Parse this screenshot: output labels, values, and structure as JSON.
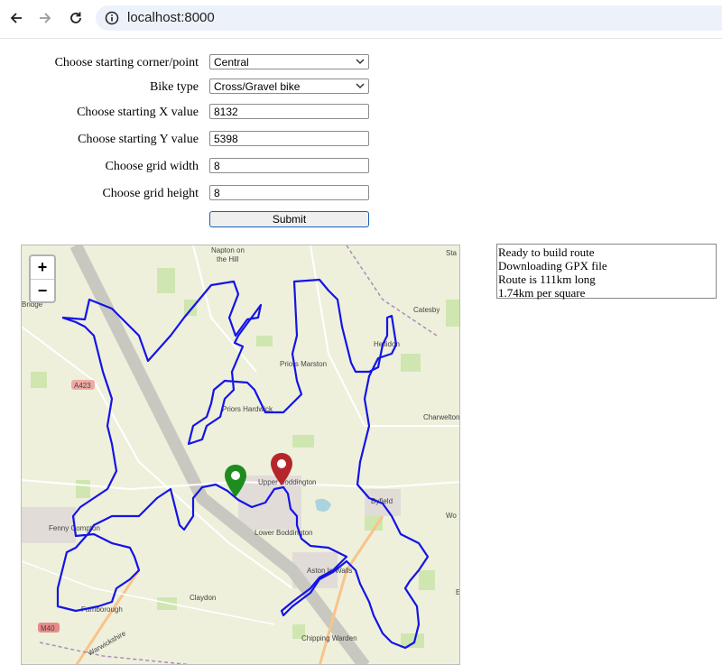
{
  "browser": {
    "url": "localhost:8000",
    "back_icon": "arrow-left-icon",
    "forward_icon": "arrow-right-icon",
    "reload_icon": "reload-icon",
    "site_info_icon": "info-icon"
  },
  "form": {
    "start_point": {
      "label": "Choose starting corner/point",
      "value": "Central"
    },
    "bike_type": {
      "label": "Bike type",
      "value": "Cross/Gravel bike"
    },
    "start_x": {
      "label": "Choose starting X value",
      "value": "8132"
    },
    "start_y": {
      "label": "Choose starting Y value",
      "value": "5398"
    },
    "grid_width": {
      "label": "Choose grid width",
      "value": "8"
    },
    "grid_height": {
      "label": "Choose grid height",
      "value": "8"
    },
    "submit_label": "Submit"
  },
  "map": {
    "zoom_in": "+",
    "zoom_out": "−",
    "route_color": "#1414e6",
    "start_marker_color": "#1e8c1e",
    "end_marker_color": "#b5262b",
    "places": {
      "napton": "Napton on",
      "napton2": "the Hill",
      "bridge": "Bridge",
      "priors_marston": "Priors Marston",
      "priors_hardwick": "Priors Hardwick",
      "catesby": "Catesby",
      "hellidon": "Hellidon",
      "charwelton": "Charwelton",
      "upper_boddington": "Upper Boddington",
      "byfield": "Byfield",
      "fenny_compton": "Fenny Compton",
      "lower_boddington": "Lower Boddington",
      "aston_walls": "Aston le Walls",
      "claydon": "Claydon",
      "farnborough": "Farnborough",
      "chipping_warden": "Chipping Warden",
      "a423": "A423",
      "m40": "M40",
      "warwickshire": "Warwickshire",
      "wo": "Wo",
      "sta": "Sta",
      "e": "E"
    }
  },
  "status": [
    "Ready to build route",
    "Downloading GPX file",
    "Route is 111km long",
    "1.74km per square"
  ]
}
